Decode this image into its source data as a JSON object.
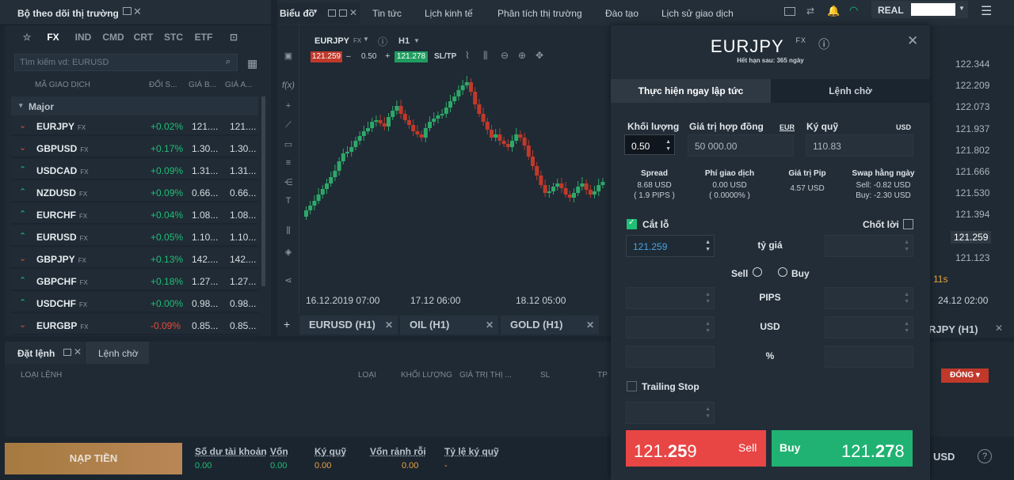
{
  "left_panel": {
    "title": "Bộ theo dõi thị trường",
    "tabs": [
      "FX",
      "IND",
      "CMD",
      "CRT",
      "STC",
      "ETF"
    ],
    "search_placeholder": "Tìm kiếm vd: EURUSD",
    "columns": [
      "MÃ GIAO DỊCH",
      "ĐỔI S...",
      "GIÁ B...",
      "GIÁ A..."
    ],
    "group": "Major",
    "rows": [
      {
        "symbol": "EURJPY",
        "tag": "FX",
        "change": "+0.02%",
        "bid": "121....",
        "ask": "121....",
        "dir": "down"
      },
      {
        "symbol": "GBPUSD",
        "tag": "FX",
        "change": "+0.17%",
        "bid": "1.30...",
        "ask": "1.30...",
        "dir": "down"
      },
      {
        "symbol": "USDCAD",
        "tag": "FX",
        "change": "+0.09%",
        "bid": "1.31...",
        "ask": "1.31...",
        "dir": "up"
      },
      {
        "symbol": "NZDUSD",
        "tag": "FX",
        "change": "+0.09%",
        "bid": "0.66...",
        "ask": "0.66...",
        "dir": "up"
      },
      {
        "symbol": "EURCHF",
        "tag": "FX",
        "change": "+0.04%",
        "bid": "1.08...",
        "ask": "1.08...",
        "dir": "up"
      },
      {
        "symbol": "EURUSD",
        "tag": "FX",
        "change": "+0.05%",
        "bid": "1.10...",
        "ask": "1.10...",
        "dir": "up"
      },
      {
        "symbol": "GBPJPY",
        "tag": "FX",
        "change": "+0.13%",
        "bid": "142....",
        "ask": "142....",
        "dir": "down"
      },
      {
        "symbol": "GBPCHF",
        "tag": "FX",
        "change": "+0.18%",
        "bid": "1.27...",
        "ask": "1.27...",
        "dir": "up"
      },
      {
        "symbol": "USDCHF",
        "tag": "FX",
        "change": "+0.00%",
        "bid": "0.98...",
        "ask": "0.98...",
        "dir": "up"
      },
      {
        "symbol": "EURGBP",
        "tag": "FX",
        "change": "-0.09%",
        "bid": "0.85...",
        "ask": "0.85...",
        "dir": "down"
      }
    ]
  },
  "top_nav": {
    "chart_tab": "Biểu đồ",
    "items": [
      "Tin tức",
      "Lịch kinh tế",
      "Phân tích thị trường",
      "Đào tạo",
      "Lịch sử giao dịch"
    ],
    "account_mode": "REAL"
  },
  "chart": {
    "symbol": "EURJPY",
    "symbol_tag": "FX",
    "timeframe": "H1",
    "sell_price": "121.259",
    "volume": "0.50",
    "buy_price": "121.278",
    "sltp": "SL/TP",
    "x_labels": [
      "16.12.2019 07:00",
      "17.12 06:00",
      "18.12 05:00"
    ],
    "bottom_tabs": [
      "EURUSD (H1)",
      "OIL (H1)",
      "GOLD (H1)",
      "RJPY (H1)"
    ]
  },
  "price_scale": {
    "prices": [
      "122.344",
      "122.209",
      "122.073",
      "121.937",
      "121.802",
      "121.666",
      "121.530",
      "121.394",
      "121.259",
      "121.123"
    ],
    "countdown": "11s",
    "time_label": "24.12 02:00"
  },
  "order_dialog": {
    "symbol": "EURJPY",
    "symbol_tag": "FX",
    "expiry": "Hết hạn sau: 365 ngày",
    "tab_instant": "Thực hiện ngay lập tức",
    "tab_pending": "Lệnh chờ",
    "volume_label": "Khối lượng",
    "volume_value": "0.50",
    "contract_label": "Giá trị hợp đồng",
    "contract_currency": "EUR",
    "contract_value": "50 000.00",
    "margin_label": "Ký quỹ",
    "margin_currency": "USD",
    "margin_value": "110.83",
    "spread_label": "Spread",
    "spread_value": "8.68 USD",
    "spread_pips": "( 1.9 PIPS )",
    "fee_label": "Phí giao dịch",
    "fee_value": "0.00 USD",
    "fee_pct": "( 0.0000% )",
    "pip_label": "Giá trị Pip",
    "pip_value": "4.57 USD",
    "swap_label": "Swap hằng ngày",
    "swap_sell": "Sell: -0.82 USD",
    "swap_buy": "Buy: -2.30 USD",
    "stop_loss_label": "Cắt lỗ",
    "take_profit_label": "Chốt lời",
    "stop_loss_value": "121.259",
    "rate_label": "tỷ giá",
    "sell_radio": "Sell",
    "buy_radio": "Buy",
    "pips_label": "PIPS",
    "usd_label": "USD",
    "pct_label": "%",
    "trailing_label": "Trailing Stop",
    "sell_btn_label": "Sell",
    "sell_price_a": "121.",
    "sell_price_b": "25",
    "sell_price_c": "9",
    "buy_btn_label": "Buy",
    "buy_price_a": "121.",
    "buy_price_b": "27",
    "buy_price_c": "8"
  },
  "orders_panel": {
    "tab_orders": "Đặt lệnh",
    "tab_pending": "Lệnh chờ",
    "columns": [
      "LOẠI LỆNH",
      "LOẠI",
      "KHỐI LƯỢNG",
      "GIÁ TRỊ THỊ ...",
      "SL",
      "TP"
    ],
    "close_btn": "ĐÓNG"
  },
  "footer": {
    "deposit": "NẠP TIỀN",
    "items": [
      {
        "label": "Số dư tài khoản",
        "value": "0.00"
      },
      {
        "label": "Vốn",
        "value": "0.00"
      },
      {
        "label": "Ký quỹ",
        "value": "0.00"
      },
      {
        "label": "Vốn rảnh rỗi",
        "value": "0.00"
      },
      {
        "label": "Tỷ lệ ký quỹ",
        "value": "-"
      }
    ],
    "currency": "USD",
    "help": "?"
  }
}
